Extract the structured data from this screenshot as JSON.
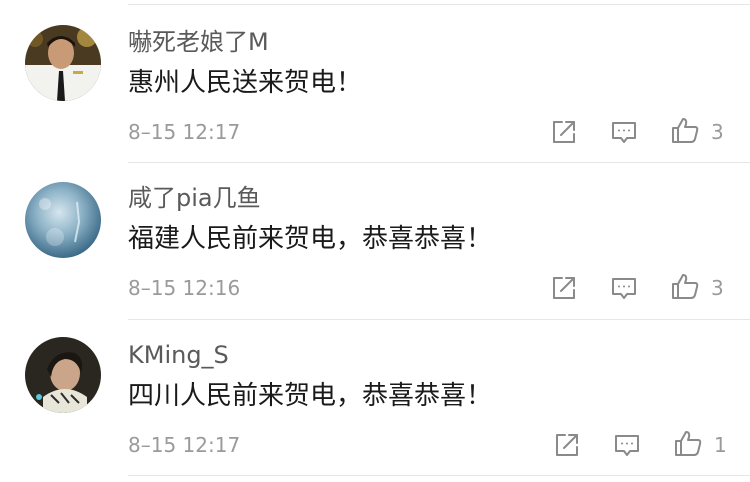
{
  "comments": [
    {
      "username": "嚇死老娘了M",
      "content": "惠州人民送来贺电！",
      "time": "8–15 12:17",
      "likes": "3"
    },
    {
      "username": "咸了pia几鱼",
      "content": "福建人民前来贺电，恭喜恭喜！",
      "time": "8–15 12:16",
      "likes": "3"
    },
    {
      "username": "KMing_S",
      "content": "四川人民前来贺电，恭喜恭喜！",
      "time": "8–15 12:17",
      "likes": "1"
    }
  ],
  "icons": {
    "share": "share-icon",
    "reply": "comment-icon",
    "like": "thumbs-up-icon"
  },
  "colors": {
    "icon": "#8a8a8a",
    "username": "#5a5a5a",
    "content": "#1a1a1a",
    "meta": "#9a9a9a",
    "divider": "#e6e6e6"
  }
}
